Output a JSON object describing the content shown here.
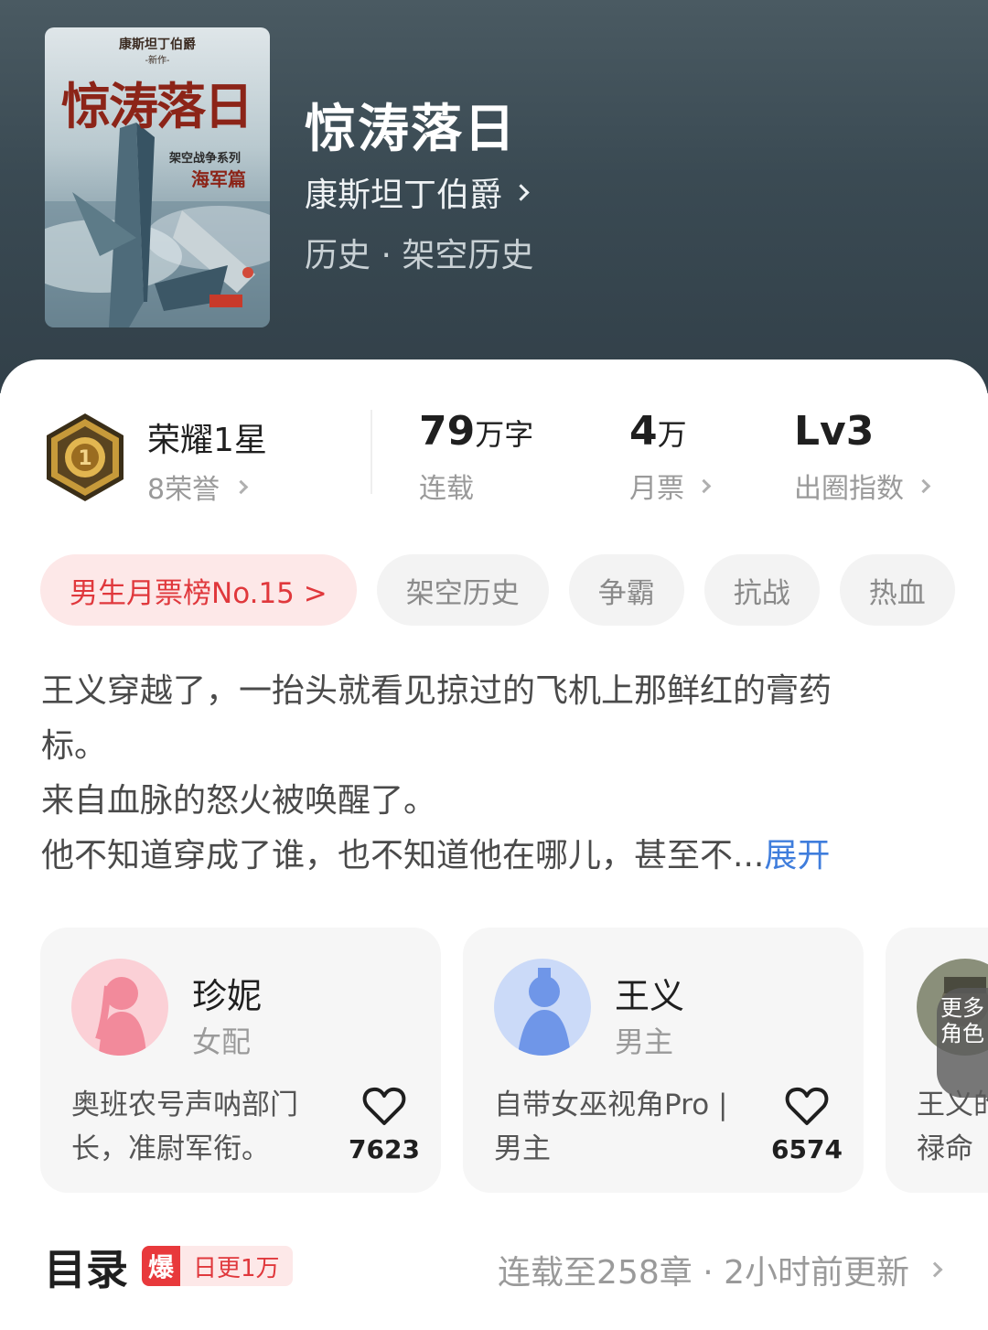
{
  "book": {
    "title": "惊涛落日",
    "author": "康斯坦丁伯爵",
    "genre": "历史 · 架空历史",
    "cover": {
      "author": "康斯坦丁伯爵",
      "new_work": "-新作-",
      "title": "惊涛落日",
      "series": "架空战争系列",
      "subtitle": "海军篇"
    }
  },
  "stats": {
    "honor_title": "荣耀1星",
    "honor_sub": "8荣誉",
    "words_value": "79",
    "words_unit": "万字",
    "words_label": "连载",
    "votes_value": "4",
    "votes_unit": "万",
    "votes_label": "月票",
    "level_value": "Lv3",
    "level_label": "出圈指数"
  },
  "tags": [
    "男生月票榜No.15 >",
    "架空历史",
    "争霸",
    "抗战",
    "热血"
  ],
  "description": {
    "line1": "王义穿越了，一抬头就看见掠过的飞机上那鲜红的膏药",
    "line2": "标。",
    "line3": "来自血脉的怒火被唤醒了。",
    "line4": "他不知道穿成了谁，也不知道他在哪儿，甚至不...",
    "expand": "展开"
  },
  "characters": [
    {
      "name": "珍妮",
      "role": "女配",
      "desc": "奥班农号声呐部门长，准尉军衔。",
      "likes": "7623",
      "avatar_color": "#f4a3b0"
    },
    {
      "name": "王义",
      "role": "男主",
      "desc": "自带女巫视角Pro | 男主",
      "likes": "6574",
      "avatar_color": "#7fa4ee"
    },
    {
      "name": "",
      "role": "",
      "desc": "王义的禄命",
      "likes": ""
    }
  ],
  "more_characters": "更多角色",
  "toc": {
    "title": "目录",
    "badge_icon": "爆",
    "badge_text": "日更1万",
    "status": "连载至258章 · 2小时前更新"
  },
  "colors": {
    "accent_red": "#e0383c",
    "link_blue": "#3f7ddc",
    "header_bg": "#3a4a53"
  }
}
